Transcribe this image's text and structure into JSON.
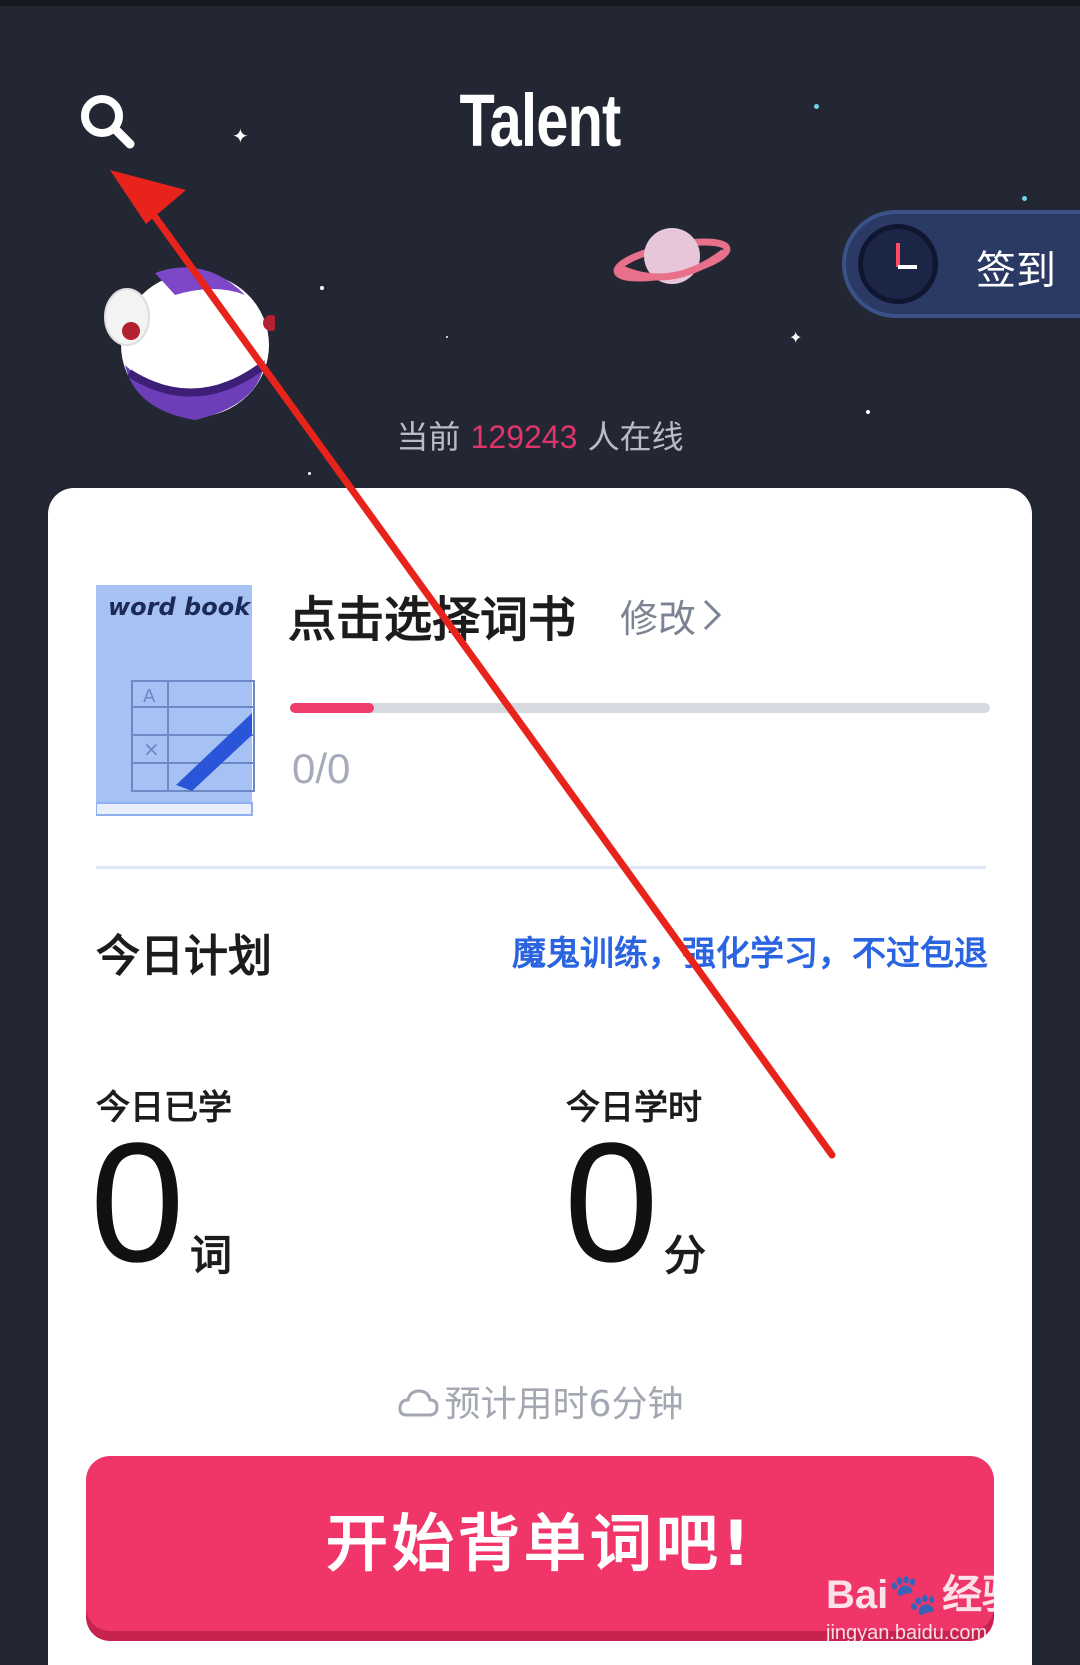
{
  "header": {
    "title": "Talent",
    "search_icon": "search-icon",
    "checkin_label": "签到",
    "checkin_icon": "clock-icon"
  },
  "online": {
    "prefix": "当前",
    "count": "129243",
    "suffix": "人在线",
    "count_color": "#e0356a"
  },
  "book": {
    "cover_text": "word book",
    "cover_letters": [
      "A",
      "×"
    ],
    "title": "点击选择词书",
    "modify_label": "修改",
    "progress_text": "0/0",
    "progress_fraction": 0.12,
    "progress_color": "#ef3d6c"
  },
  "plan": {
    "title": "今日计划",
    "slogan": "魔鬼训练，强化学习，不过包退",
    "learned_label": "今日已学",
    "learned_value": "0",
    "learned_unit": "词",
    "time_label": "今日学时",
    "time_value": "0",
    "time_unit": "分",
    "estimate": "预计用时6分钟"
  },
  "start_button": {
    "label": "开始背单词吧!",
    "color": "#f03669"
  },
  "watermark": {
    "brand": "Bai",
    "brand_cn": "经验",
    "url": "jingyan.baidu.com"
  },
  "colors": {
    "background": "#222733",
    "accent_pink": "#f03669",
    "link_blue": "#2a64e0",
    "annotation_arrow": "#e8231b"
  }
}
